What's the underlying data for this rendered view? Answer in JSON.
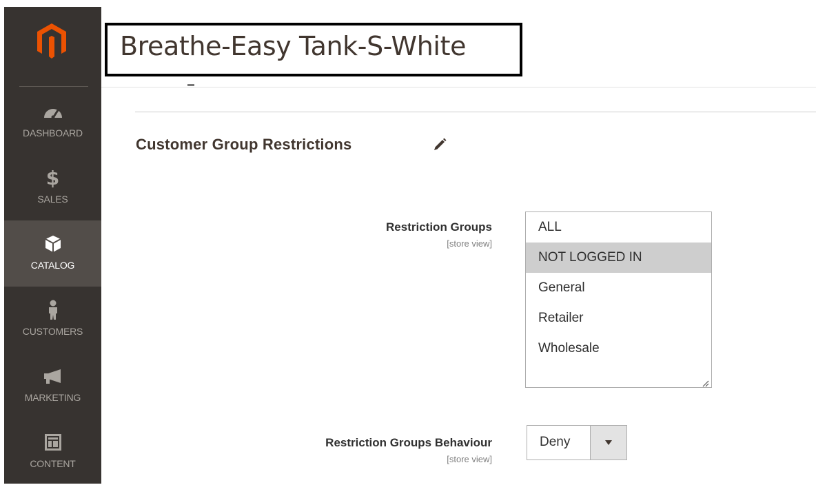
{
  "sidebar": {
    "items": [
      {
        "label": "DASHBOARD",
        "icon": "dashboard-gauge-icon"
      },
      {
        "label": "SALES",
        "icon": "dollar-icon"
      },
      {
        "label": "CATALOG",
        "icon": "box-icon"
      },
      {
        "label": "CUSTOMERS",
        "icon": "person-icon"
      },
      {
        "label": "MARKETING",
        "icon": "megaphone-icon"
      },
      {
        "label": "CONTENT",
        "icon": "layout-icon"
      }
    ],
    "active": "CATALOG",
    "colors": {
      "background": "#373330",
      "active": "#524d49",
      "logo": "#eb5202"
    }
  },
  "header": {
    "title": "Breathe-Easy Tank-S-White"
  },
  "section": {
    "title": "Customer Group Restrictions",
    "edit_icon": "pencil-icon"
  },
  "fields": {
    "restriction_groups": {
      "label": "Restriction Groups",
      "scope": "[store view]",
      "options": [
        "ALL",
        "NOT LOGGED IN",
        "General",
        "Retailer",
        "Wholesale"
      ],
      "selected": "NOT LOGGED IN"
    },
    "restriction_behaviour": {
      "label": "Restriction Groups Behaviour",
      "scope": "[store view]",
      "value": "Deny"
    }
  }
}
